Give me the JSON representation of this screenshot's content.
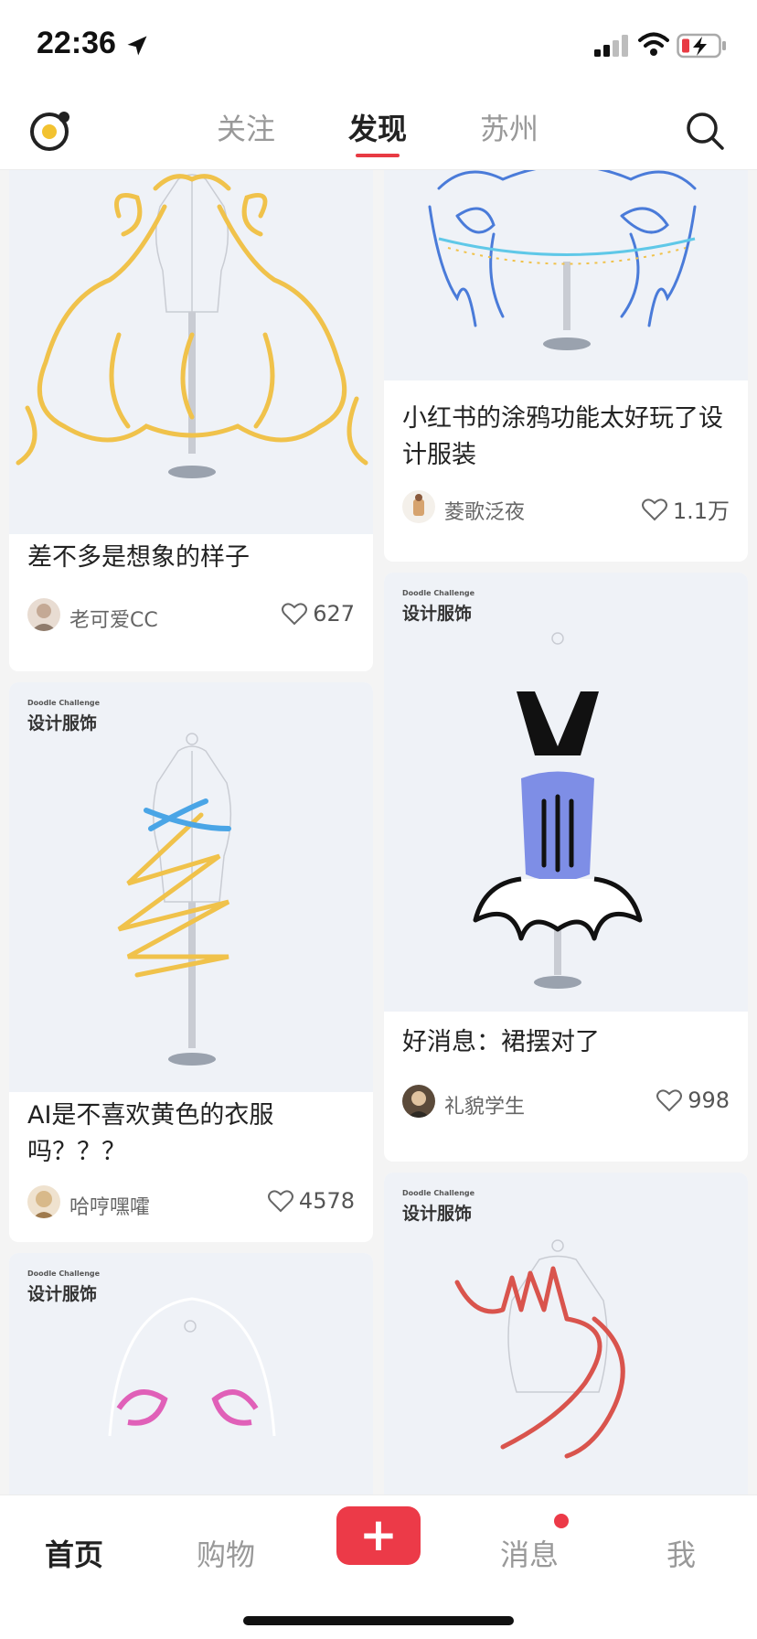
{
  "status_bar": {
    "time": "22:36"
  },
  "top_nav": {
    "tabs": [
      {
        "label": "关注",
        "active": false
      },
      {
        "label": "发现",
        "active": true
      },
      {
        "label": "苏州",
        "active": false
      }
    ]
  },
  "feed": {
    "cards": [
      {
        "title": "差不多是想象的样子",
        "author": "老可爱CC",
        "likes": "627",
        "badge_sub": "",
        "badge_title": "",
        "doodle_color": "#f0c24b"
      },
      {
        "title": "小红书的涂鸦功能太好玩了设计服装",
        "author": "菱歌泛夜",
        "likes": "1.1万",
        "badge_sub": "",
        "badge_title": "",
        "doodle_color": "#4a7bd9"
      },
      {
        "title": "AI是不喜欢黄色的衣服吗？？？",
        "author": "哈哼嘿嚯",
        "likes": "4578",
        "badge_sub": "Doodle Challenge",
        "badge_title": "设计服饰",
        "doodle_color": "#f0c24b"
      },
      {
        "title": "好消息：裙摆对了",
        "author": "礼貌学生",
        "likes": "998",
        "badge_sub": "Doodle Challenge",
        "badge_title": "设计服饰",
        "doodle_color": "#7b8fe6"
      },
      {
        "title": "",
        "author": "",
        "likes": "",
        "badge_sub": "Doodle Challenge",
        "badge_title": "设计服饰",
        "doodle_color": "#e060b8"
      },
      {
        "title": "",
        "author": "",
        "likes": "",
        "badge_sub": "Doodle Challenge",
        "badge_title": "设计服饰",
        "doodle_color": "#d9544d"
      }
    ]
  },
  "tab_bar": {
    "items": [
      {
        "label": "首页",
        "active": true
      },
      {
        "label": "购物",
        "active": false
      },
      {
        "label": "消息",
        "active": false,
        "has_dot": true
      },
      {
        "label": "我",
        "active": false
      }
    ],
    "add_icon": "plus-icon"
  },
  "colors": {
    "accent": "#ec3a48",
    "background": "#f4f4f4",
    "card_image_bg": "#eff2f7"
  }
}
